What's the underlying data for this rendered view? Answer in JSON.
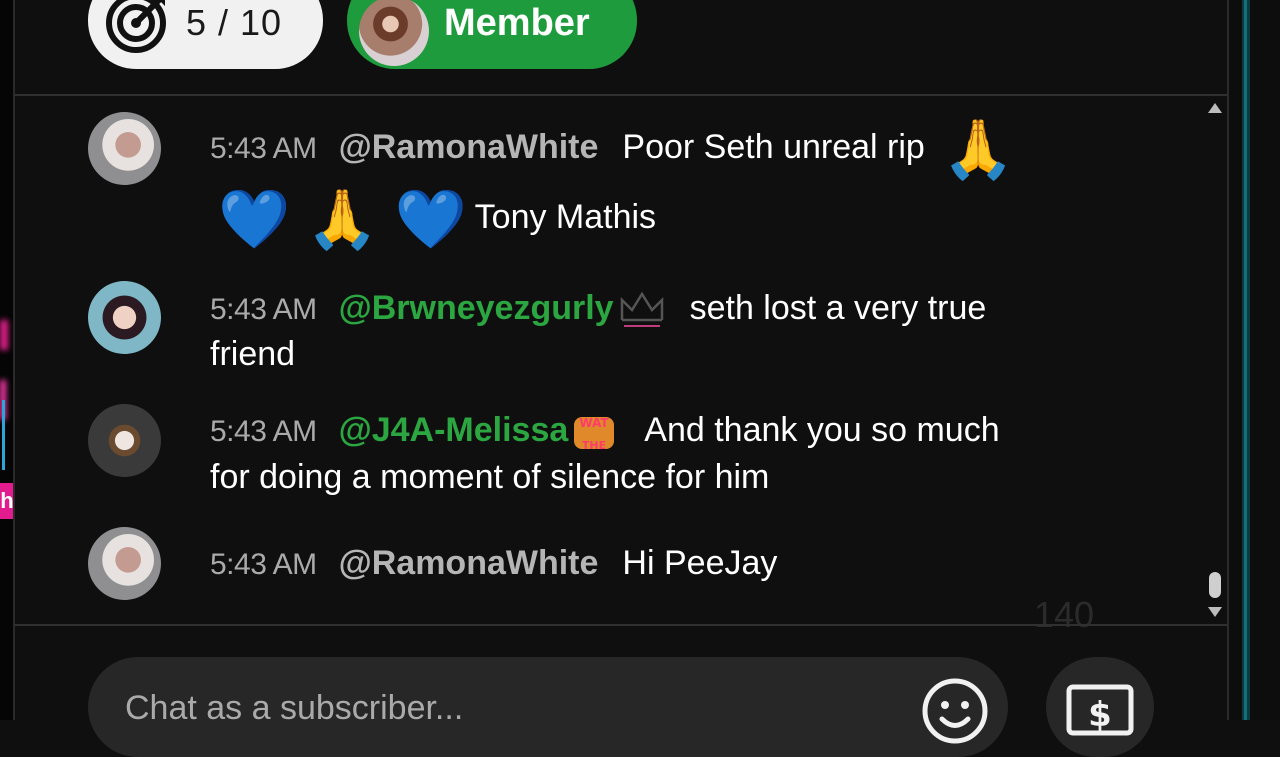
{
  "header": {
    "goal_count": "5 / 10",
    "member_label": "Member"
  },
  "messages": [
    {
      "time": "5:43 AM",
      "author": "@RamonaWhite",
      "text_line1": "Poor Seth unreal rip",
      "text_line2": "Tony Mathis",
      "emoji": [
        "🙏",
        "💙",
        "🙏",
        "💙"
      ]
    },
    {
      "time": "5:43 AM",
      "author": "@Brwneyezgurly",
      "badge": "crown-badge",
      "text_line1": "seth lost a very true",
      "text_line2": "friend"
    },
    {
      "time": "5:43 AM",
      "author": "@J4A-Melissa",
      "badge": "wat-the-badge",
      "text_line1": "And thank you so much",
      "text_line2": "for doing a moment of silence for him"
    },
    {
      "time": "5:43 AM",
      "author": "@RamonaWhite",
      "text_line1": "Hi PeeJay"
    }
  ],
  "viewer_count": "140",
  "input": {
    "placeholder": "Chat as a subscriber..."
  },
  "colors": {
    "member_green": "#1e9c3d",
    "author_green": "#2ba640",
    "heart_blue": "#1f7fe0",
    "background": "#0f0f0f"
  },
  "icons": [
    "target-icon",
    "emoji-icon",
    "super-chat-icon",
    "scroll-up-icon",
    "scroll-down-icon"
  ]
}
